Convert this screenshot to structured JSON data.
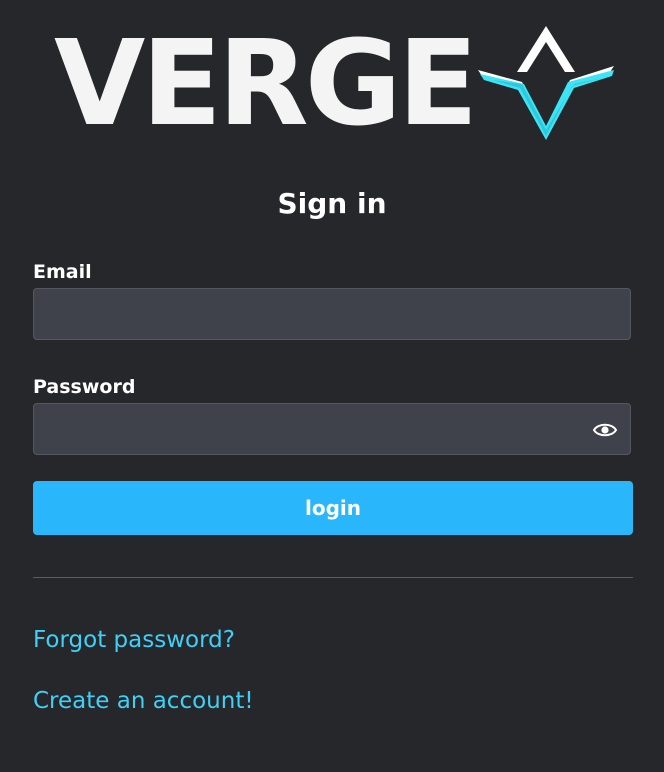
{
  "brand": {
    "name": "VERGE",
    "colors": {
      "background": "#26272b",
      "accent": "#3de4f5",
      "button": "#2ab6fb",
      "link": "#3fd0f7",
      "input_bg": "#40424b"
    }
  },
  "form": {
    "title": "Sign in",
    "email_label": "Email",
    "email_value": "",
    "password_label": "Password",
    "password_value": "",
    "show_password_icon": "eye-icon",
    "submit_label": "login"
  },
  "links": {
    "forgot_password": "Forgot password?",
    "create_account": "Create an account!"
  }
}
